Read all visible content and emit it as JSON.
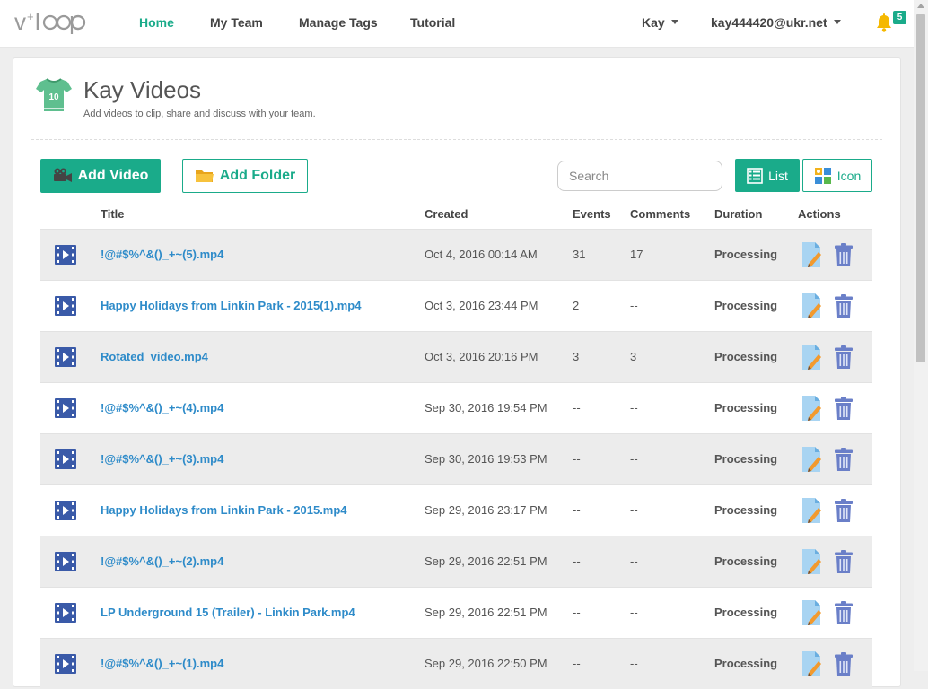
{
  "app": {
    "logo_text": "v+loop"
  },
  "nav": {
    "items": [
      {
        "label": "Home",
        "active": true
      },
      {
        "label": "My Team",
        "active": false
      },
      {
        "label": "Manage Tags",
        "active": false
      },
      {
        "label": "Tutorial",
        "active": false
      }
    ],
    "user_name": "Kay",
    "user_email": "kay444420@ukr.net",
    "notification_count": "5"
  },
  "header": {
    "title": "Kay Videos",
    "subtitle": "Add videos to clip, share and discuss with your team.",
    "jersey_number": "10"
  },
  "toolbar": {
    "add_video_label": "Add Video",
    "add_folder_label": "Add Folder",
    "search_placeholder": "Search",
    "search_value": "",
    "list_label": "List",
    "icon_label": "Icon",
    "view_mode": "list"
  },
  "table": {
    "columns": [
      "Title",
      "Created",
      "Events",
      "Comments",
      "Duration",
      "Actions"
    ],
    "rows": [
      {
        "title": "!@#$%^&()_+~(5).mp4",
        "created": "Oct 4, 2016 00:14 AM",
        "events": "31",
        "comments": "17",
        "duration": "Processing"
      },
      {
        "title": "Happy Holidays from Linkin Park - 2015(1).mp4",
        "created": "Oct 3, 2016 23:44 PM",
        "events": "2",
        "comments": "--",
        "duration": "Processing"
      },
      {
        "title": "Rotated_video.mp4",
        "created": "Oct 3, 2016 20:16 PM",
        "events": "3",
        "comments": "3",
        "duration": "Processing"
      },
      {
        "title": "!@#$%^&()_+~(4).mp4",
        "created": "Sep 30, 2016 19:54 PM",
        "events": "--",
        "comments": "--",
        "duration": "Processing"
      },
      {
        "title": "!@#$%^&()_+~(3).mp4",
        "created": "Sep 30, 2016 19:53 PM",
        "events": "--",
        "comments": "--",
        "duration": "Processing"
      },
      {
        "title": "Happy Holidays from Linkin Park - 2015.mp4",
        "created": "Sep 29, 2016 23:17 PM",
        "events": "--",
        "comments": "--",
        "duration": "Processing"
      },
      {
        "title": "!@#$%^&()_+~(2).mp4",
        "created": "Sep 29, 2016 22:51 PM",
        "events": "--",
        "comments": "--",
        "duration": "Processing"
      },
      {
        "title": "LP Underground 15 (Trailer) - Linkin Park.mp4",
        "created": "Sep 29, 2016 22:51 PM",
        "events": "--",
        "comments": "--",
        "duration": "Processing"
      },
      {
        "title": "!@#$%^&()_+~(1).mp4",
        "created": "Sep 29, 2016 22:50 PM",
        "events": "--",
        "comments": "--",
        "duration": "Processing"
      }
    ]
  },
  "icons": {
    "row_type": "film-icon",
    "edit": "edit-document-icon",
    "delete": "trash-icon",
    "notifications": "bell-icon"
  },
  "colors": {
    "accent": "#1aab8a",
    "link": "#2e8bc9",
    "icon_blue": "#3a5aa8",
    "bell": "#f5b800"
  }
}
